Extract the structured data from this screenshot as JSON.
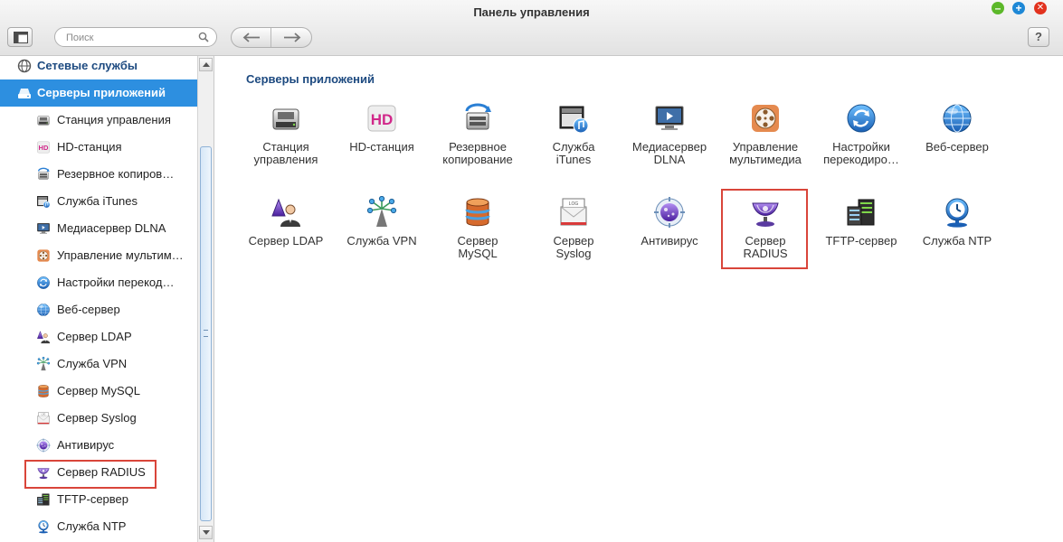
{
  "window": {
    "title": "Панель управления"
  },
  "toolbar": {
    "search_placeholder": "Поиск",
    "help_label": "?"
  },
  "sidebar": {
    "parent_label": "Сетевые службы",
    "selected_label": "Серверы приложений",
    "items": [
      {
        "label": "Станция управления",
        "icon": "disk-station-icon"
      },
      {
        "label": "HD-станция",
        "icon": "hd-station-icon"
      },
      {
        "label": "Резервное копиров…",
        "icon": "backup-icon"
      },
      {
        "label": "Служба iTunes",
        "icon": "itunes-icon"
      },
      {
        "label": "Медиасервер DLNA",
        "icon": "dlna-icon"
      },
      {
        "label": "Управление мультим…",
        "icon": "multimedia-icon"
      },
      {
        "label": "Настройки перекод…",
        "icon": "transcode-icon"
      },
      {
        "label": "Веб-сервер",
        "icon": "web-server-icon"
      },
      {
        "label": "Сервер LDAP",
        "icon": "ldap-icon"
      },
      {
        "label": "Служба VPN",
        "icon": "vpn-icon"
      },
      {
        "label": "Сервер MySQL",
        "icon": "mysql-icon"
      },
      {
        "label": "Сервер Syslog",
        "icon": "syslog-icon"
      },
      {
        "label": "Антивирус",
        "icon": "antivirus-icon"
      },
      {
        "label": "Сервер RADIUS",
        "icon": "radius-icon"
      },
      {
        "label": "TFTP-сервер",
        "icon": "tftp-icon"
      },
      {
        "label": "Служба NTP",
        "icon": "ntp-icon"
      }
    ]
  },
  "main": {
    "section_title": "Серверы приложений",
    "apps": [
      {
        "line1": "Станция",
        "line2": "управления",
        "icon": "disk-station-icon"
      },
      {
        "line1": "HD-станция",
        "line2": "",
        "icon": "hd-station-icon"
      },
      {
        "line1": "Резервное",
        "line2": "копирование",
        "icon": "backup-icon"
      },
      {
        "line1": "Служба",
        "line2": "iTunes",
        "icon": "itunes-icon"
      },
      {
        "line1": "Медиасервер",
        "line2": "DLNA",
        "icon": "dlna-icon"
      },
      {
        "line1": "Управление",
        "line2": "мультимедиа",
        "icon": "multimedia-icon"
      },
      {
        "line1": "Настройки",
        "line2": "перекодиро…",
        "icon": "transcode-icon"
      },
      {
        "line1": "Веб-сервер",
        "line2": "",
        "icon": "web-server-icon"
      },
      {
        "line1": "Сервер LDAP",
        "line2": "",
        "icon": "ldap-icon"
      },
      {
        "line1": "Служба VPN",
        "line2": "",
        "icon": "vpn-icon"
      },
      {
        "line1": "Сервер",
        "line2": "MySQL",
        "icon": "mysql-icon"
      },
      {
        "line1": "Сервер",
        "line2": "Syslog",
        "icon": "syslog-icon"
      },
      {
        "line1": "Антивирус",
        "line2": "",
        "icon": "antivirus-icon"
      },
      {
        "line1": "Сервер",
        "line2": "RADIUS",
        "icon": "radius-icon"
      },
      {
        "line1": "TFTP-сервер",
        "line2": "",
        "icon": "tftp-icon"
      },
      {
        "line1": "Служба NTP",
        "line2": "",
        "icon": "ntp-icon"
      }
    ]
  },
  "colors": {
    "selected": "#2d8fe0",
    "heading": "#1d4a80",
    "highlight": "#d9453a"
  }
}
